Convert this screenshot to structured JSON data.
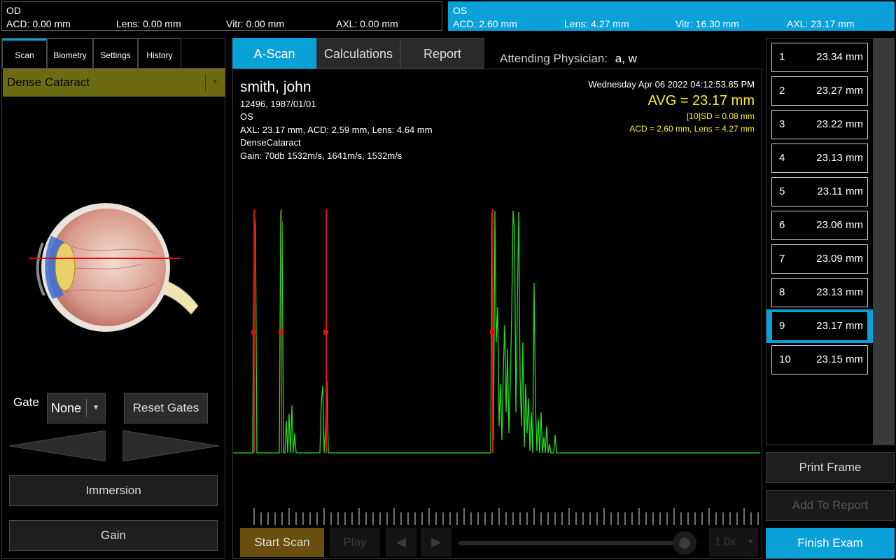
{
  "od": {
    "label": "OD",
    "acd": "ACD: 0.00 mm",
    "lens": "Lens: 0.00 mm",
    "vitr": "Vitr: 0.00 mm",
    "axl": "AXL: 0.00 mm"
  },
  "os": {
    "label": "OS",
    "acd": "ACD: 2.60 mm",
    "lens": "Lens: 4.27 mm",
    "vitr": "Vitr: 16.30 mm",
    "axl": "AXL: 23.17 mm"
  },
  "left_tabs": [
    "Scan",
    "Biometry",
    "Settings",
    "History"
  ],
  "mode_select": "Dense Cataract",
  "gate": {
    "label": "Gate",
    "value": "None",
    "reset_label": "Reset Gates"
  },
  "buttons": {
    "immersion": "Immersion",
    "gain": "Gain"
  },
  "center_tabs": [
    "A-Scan",
    "Calculations",
    "Report"
  ],
  "physician": {
    "label": "Attending Physician:",
    "value": "a, w"
  },
  "patient": {
    "name": "smith, john",
    "id_dob": "12496, 1987/01/01",
    "eye": "OS",
    "measurements": "AXL: 23.17 mm,  ACD: 2.59 mm,  Lens: 4.64 mm",
    "mode": "DenseCataract",
    "gain": "Gain: 70db 1532m/s, 1641m/s, 1532m/s"
  },
  "scan": {
    "datetime": "Wednesday Apr 06 2022   04:12:53.85 PM",
    "avg": "AVG = 23.17 mm",
    "sd": "[10]SD = 0.08 mm",
    "acd_lens": "ACD = 2.60 mm, Lens = 4.27 mm"
  },
  "player": {
    "start_scan": "Start Scan",
    "play": "Play",
    "step_back": "◀",
    "step_fwd": "▶",
    "speed": "1.0x"
  },
  "measurement_list": [
    {
      "index": "1",
      "value": "23.34 mm"
    },
    {
      "index": "2",
      "value": "23.27 mm"
    },
    {
      "index": "3",
      "value": "23.22 mm"
    },
    {
      "index": "4",
      "value": "23.13 mm"
    },
    {
      "index": "5",
      "value": "23.11 mm"
    },
    {
      "index": "6",
      "value": "23.06 mm"
    },
    {
      "index": "7",
      "value": "23.09 mm"
    },
    {
      "index": "8",
      "value": "23.13 mm"
    },
    {
      "index": "9",
      "value": "23.17 mm"
    },
    {
      "index": "10",
      "value": "23.15 mm"
    }
  ],
  "selected_measurement": 9,
  "right_buttons": {
    "print_frame": "Print Frame",
    "add_to_report": "Add To Report",
    "finish_exam": "Finish Exam"
  },
  "colors": {
    "accent": "#0aa0d8",
    "waveform": "#22dd22",
    "gate": "#e01010",
    "highlight_text": "#ffef1a",
    "mode_bg": "#6d6b12"
  }
}
